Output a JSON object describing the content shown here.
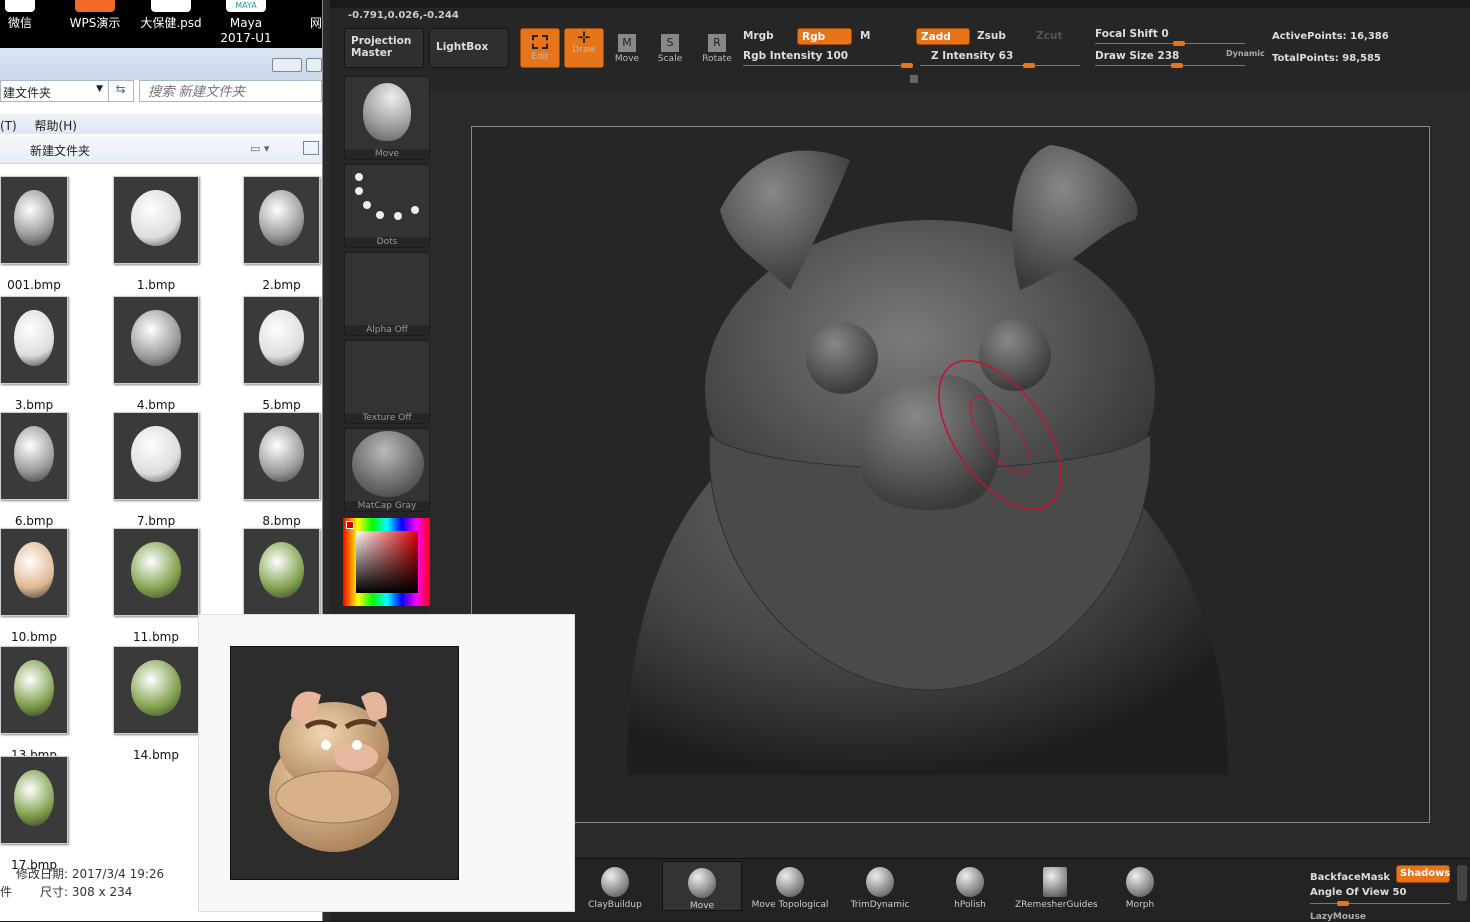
{
  "desktop": {
    "icons": [
      {
        "label": "微信"
      },
      {
        "label": "WPS演示"
      },
      {
        "label": "大保健.psd"
      },
      {
        "label": "Maya",
        "sub": "2017-U1",
        "badge": "MAYA"
      },
      {
        "label": "网"
      }
    ]
  },
  "explorer": {
    "address": "建文件夹",
    "search_placeholder": "搜索 新建文件夹",
    "menu": [
      "(T)",
      "帮助(H)"
    ],
    "breadcrumb": "新建文件夹",
    "files": [
      {
        "name": "001.bmp"
      },
      {
        "name": "1.bmp"
      },
      {
        "name": "2.bmp"
      },
      {
        "name": "3.bmp"
      },
      {
        "name": "4.bmp"
      },
      {
        "name": "5.bmp"
      },
      {
        "name": "6.bmp"
      },
      {
        "name": "7.bmp"
      },
      {
        "name": "8.bmp"
      },
      {
        "name": "10.bmp"
      },
      {
        "name": "11.bmp"
      },
      {
        "name": ""
      },
      {
        "name": "13.bmp"
      },
      {
        "name": "14.bmp"
      },
      {
        "name": "17.bmp"
      }
    ],
    "details": {
      "modified": "修改日期: 2017/3/4 19:26",
      "type": "件",
      "size": "尺寸: 308 x 234"
    }
  },
  "zbrush": {
    "coords": "-0.791,0.026,-0.244",
    "toolbar": {
      "projection_master": "Projection Master",
      "lightbox": "LightBox",
      "edit": "Edit",
      "draw": "Draw",
      "move": "Move",
      "scale": "Scale",
      "rotate": "Rotate",
      "move_key": "M",
      "scale_key": "S",
      "rotate_key": "R",
      "mrgb": "Mrgb",
      "rgb": "Rgb",
      "m": "M",
      "rgb_intensity": "Rgb  Intensity 100",
      "zadd": "Zadd",
      "zsub": "Zsub",
      "zcut": "Zcut",
      "z_intensity": "Z  Intensity 63",
      "focal_shift": "Focal  Shift 0",
      "draw_size": "Draw  Size 238",
      "dynamic": "Dynamic",
      "active_points": "ActivePoints: 16,386",
      "total_points": "TotalPoints: 98,585"
    },
    "sliders": {
      "rgb_intensity": 100,
      "z_intensity": 63,
      "focal_shift": 0,
      "draw_size": 238,
      "angle_of_view": 50
    },
    "shelf": [
      {
        "label": "Move"
      },
      {
        "label": "Dots"
      },
      {
        "label": "Alpha  Off"
      },
      {
        "label": "Texture  Off"
      },
      {
        "label": "MatCap  Gray"
      }
    ],
    "brushes": [
      {
        "label": "ClayBuildup"
      },
      {
        "label": "Move"
      },
      {
        "label": "Move  Topological"
      },
      {
        "label": "TrimDynamic"
      },
      {
        "label": "hPolish"
      },
      {
        "label": "ZRemesherGuides"
      },
      {
        "label": "Morph"
      }
    ],
    "right": {
      "backface": "BackfaceMask",
      "shadows": "Shadows",
      "angle": "Angle  Of  View 50",
      "lazy": "LazyMouse"
    },
    "colors": {
      "accent": "#e8741a",
      "bg": "#262626",
      "stroke": "#c8102e"
    }
  }
}
